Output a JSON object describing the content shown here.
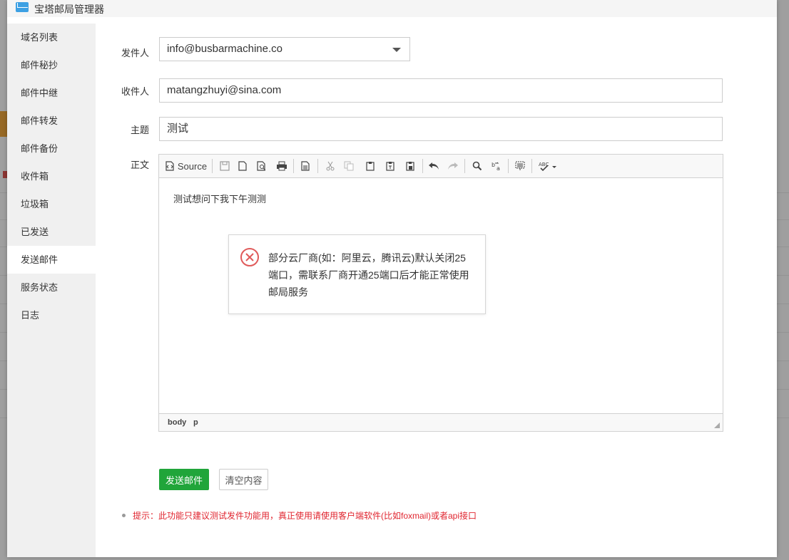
{
  "window": {
    "title": "宝塔邮局管理器"
  },
  "sidebar": {
    "items": [
      {
        "label": "域名列表"
      },
      {
        "label": "邮件秘抄"
      },
      {
        "label": "邮件中继"
      },
      {
        "label": "邮件转发"
      },
      {
        "label": "邮件备份"
      },
      {
        "label": "收件箱"
      },
      {
        "label": "垃圾箱"
      },
      {
        "label": "已发送"
      },
      {
        "label": "发送邮件",
        "active": true
      },
      {
        "label": "服务状态"
      },
      {
        "label": "日志"
      }
    ]
  },
  "form": {
    "sender_label": "发件人",
    "sender_value": "info@busbarmachine.co",
    "recipient_label": "收件人",
    "recipient_value": "matangzhuyi@sina.com",
    "subject_label": "主题",
    "subject_value": "测试",
    "body_label": "正文"
  },
  "editor": {
    "source_label": "Source",
    "content": "测试想问下我下午测测",
    "path": [
      "body",
      "p"
    ]
  },
  "alert": {
    "message": "部分云厂商(如：阿里云，腾讯云)默认关闭25端口，需联系厂商开通25端口后才能正常使用邮局服务"
  },
  "buttons": {
    "send": "发送邮件",
    "clear": "清空内容"
  },
  "tip": "提示：此功能只建议测试发件功能用，真正使用请使用客户端软件(比如foxmail)或者api接口",
  "colors": {
    "accent_green": "#20a53a",
    "tip_red": "#e0252f",
    "error_red": "#e05a5a",
    "title_icon_blue": "#3da0e3"
  }
}
